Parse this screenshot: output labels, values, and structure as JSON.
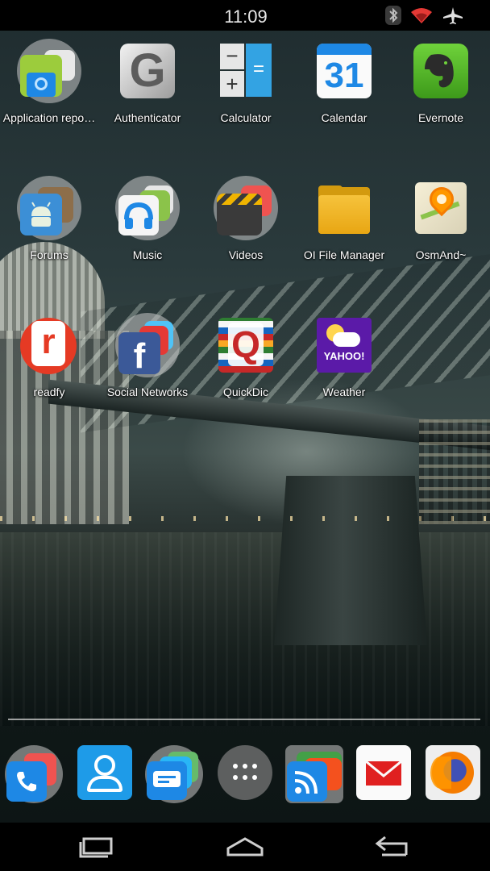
{
  "status_bar": {
    "time": "11:09",
    "icons": [
      "bluetooth-icon",
      "wifi-icon",
      "airplane-mode-icon"
    ]
  },
  "apps": [
    {
      "label": "Application repo…",
      "icon": "application-reports-folder-icon"
    },
    {
      "label": "Authenticator",
      "icon": "authenticator-icon"
    },
    {
      "label": "Calculator",
      "icon": "calculator-icon"
    },
    {
      "label": "Calendar",
      "icon": "calendar-icon",
      "badge": "31"
    },
    {
      "label": "Evernote",
      "icon": "evernote-icon"
    },
    {
      "label": "Forums",
      "icon": "forums-folder-icon"
    },
    {
      "label": "Music",
      "icon": "music-folder-icon"
    },
    {
      "label": "Videos",
      "icon": "videos-folder-icon"
    },
    {
      "label": "OI File Manager",
      "icon": "file-manager-icon"
    },
    {
      "label": "OsmAnd~",
      "icon": "osmand-map-icon"
    },
    {
      "label": "readfy",
      "icon": "readfy-icon",
      "letter": "r"
    },
    {
      "label": "Social Networks",
      "icon": "social-networks-folder-icon",
      "letter": "f"
    },
    {
      "label": "QuickDic",
      "icon": "quickdic-icon",
      "letter": "Q"
    },
    {
      "label": "Weather",
      "icon": "yahoo-weather-icon",
      "text": "YAHOO!"
    }
  ],
  "dock": [
    {
      "name": "phone-folder",
      "icon": "phone-icon"
    },
    {
      "name": "contacts",
      "icon": "contacts-icon"
    },
    {
      "name": "messaging-folder",
      "icon": "messaging-icon"
    },
    {
      "name": "all-apps",
      "icon": "app-drawer-icon"
    },
    {
      "name": "rss-folder",
      "icon": "rss-icon"
    },
    {
      "name": "email",
      "icon": "email-icon"
    },
    {
      "name": "firefox",
      "icon": "firefox-icon"
    }
  ],
  "nav": [
    "recent-apps-icon",
    "home-icon",
    "back-icon"
  ],
  "colors": {
    "status_bar": "#000000",
    "wifi": "#e53935",
    "calendar_blue": "#1e88e5",
    "evernote_green": "#5cb82a",
    "readfy_red": "#e53a24",
    "yahoo_purple": "#5b1aa8",
    "email_red": "#e02020"
  }
}
